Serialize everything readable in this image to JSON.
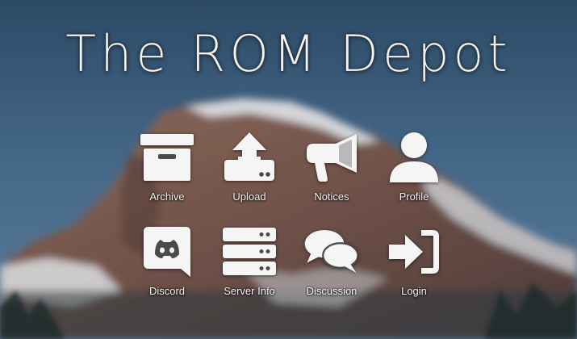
{
  "site": {
    "title": "The ROM Depot"
  },
  "tiles": [
    {
      "label": "Archive",
      "icon": "archive-icon"
    },
    {
      "label": "Upload",
      "icon": "upload-icon"
    },
    {
      "label": "Notices",
      "icon": "megaphone-icon"
    },
    {
      "label": "Profile",
      "icon": "user-icon"
    },
    {
      "label": "Discord",
      "icon": "discord-icon"
    },
    {
      "label": "Server Info",
      "icon": "server-icon"
    },
    {
      "label": "Discussion",
      "icon": "chat-bubbles-icon"
    },
    {
      "label": "Login",
      "icon": "sign-in-icon"
    }
  ],
  "colors": {
    "icon": "#f5f5f5",
    "sky": "#3d5f7a",
    "rock": "#7a5a4e",
    "snow": "#dfe3e8"
  }
}
